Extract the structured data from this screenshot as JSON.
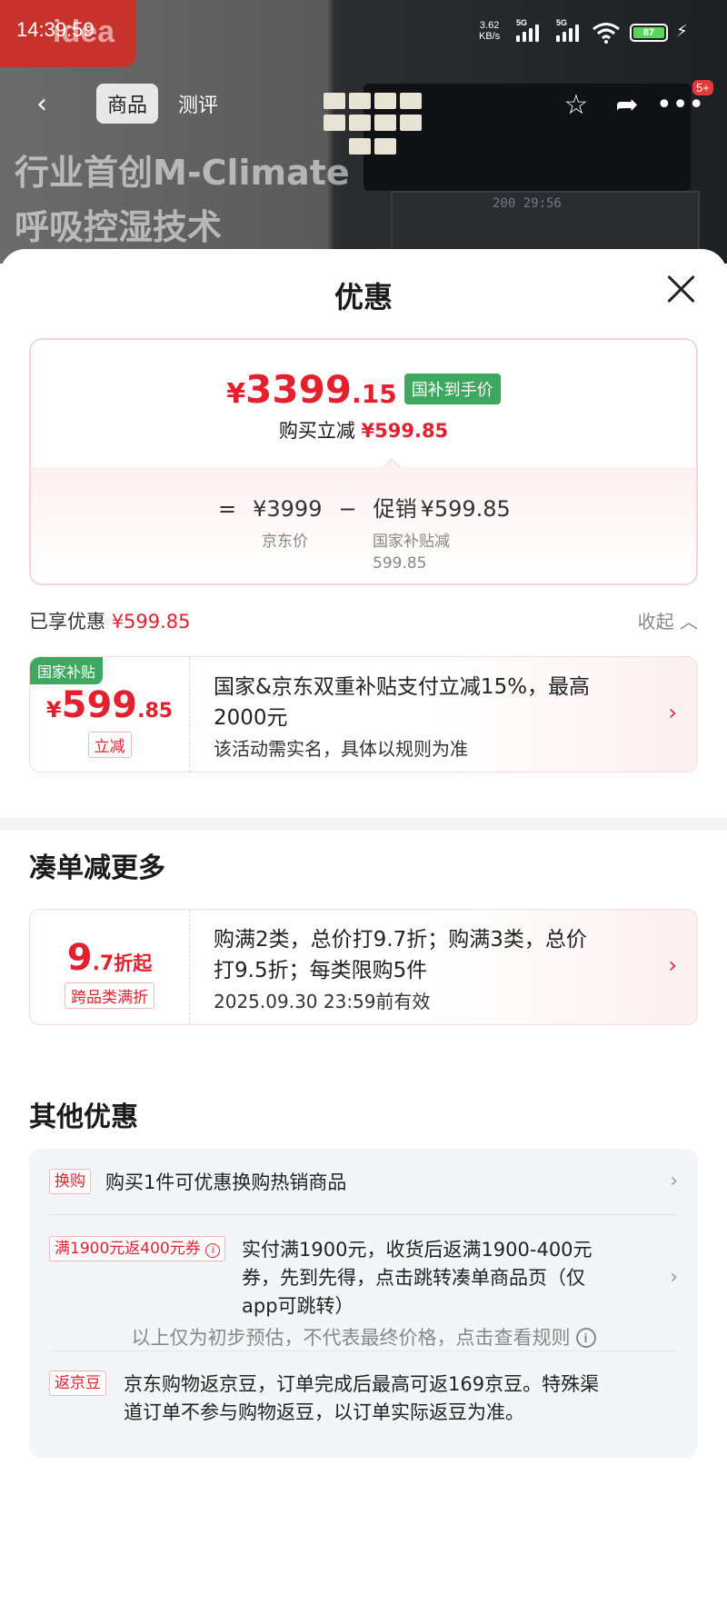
{
  "status_bar": {
    "time": "14:39:59",
    "net_speed": "3.62",
    "net_unit": "KB/s",
    "net1": "5G",
    "net2": "5G",
    "battery": "87",
    "sim_index": "6"
  },
  "background": {
    "brand": "idea",
    "headline_line1": "行业首创M-Climate",
    "headline_line2": "呼吸控湿技术",
    "oven_display": "200 29:56"
  },
  "nav": {
    "tabs": [
      "商品",
      "测评"
    ],
    "cart_count": "5+"
  },
  "sheet": {
    "title": "优惠",
    "price": {
      "currency": "¥",
      "integer": "3399",
      "decimal": ".15",
      "tag": "国补到手价",
      "sub_prefix": "购买立减",
      "sub_amount": "¥599.85",
      "formula_eq": "=",
      "jd_price": "¥3999",
      "formula_minus": "−",
      "promo_label": "促销",
      "promo_amount": "¥599.85",
      "jd_price_label": "京东价",
      "promo_desc_line1": "国家补贴减",
      "promo_desc_line2": "599.85"
    },
    "enjoyed": {
      "label": "已享优惠",
      "amount": "¥599.85",
      "collapse": "收起"
    },
    "subsidy": {
      "corner_tag": "国家补贴",
      "currency": "¥",
      "integer": "599",
      "decimal": ".85",
      "tag": "立减",
      "line1": "国家&京东双重补贴支付立减15%，最高",
      "line2": "2000元",
      "line3": "该活动需实名，具体以规则为准"
    },
    "bundle": {
      "title": "凑单减更多",
      "int": "9",
      "dec": ".7",
      "unit": "折起",
      "tag": "跨品类满折",
      "line1": "购满2类，总价打9.7折；购满3类，总价",
      "line2": "打9.5折；每类限购5件",
      "line3": "2025.09.30 23:59前有效"
    },
    "others": {
      "title": "其他优惠",
      "rows": [
        {
          "label": "换购",
          "text": "购买1件可优惠换购热销商品"
        },
        {
          "label": "满1900元返400元券",
          "line1": "实付满1900元，收货后返满1900-400元",
          "line2": "券，先到先得，点击跳转凑单商品页（仅",
          "line3": "app可跳转）"
        },
        {
          "label": "返京豆",
          "line1": "京东购物返京豆，订单完成后最高可返169京豆。特殊渠",
          "line2": "道订单不参与购物返豆，以订单实际返豆为准。"
        }
      ]
    },
    "footer": "以上仅为初步预估，不代表最终价格，点击查看规则"
  },
  "colors": {
    "accent_red": "#e5202e",
    "green_tag": "#3fa860",
    "panel_bg": "#f4f5f8"
  }
}
